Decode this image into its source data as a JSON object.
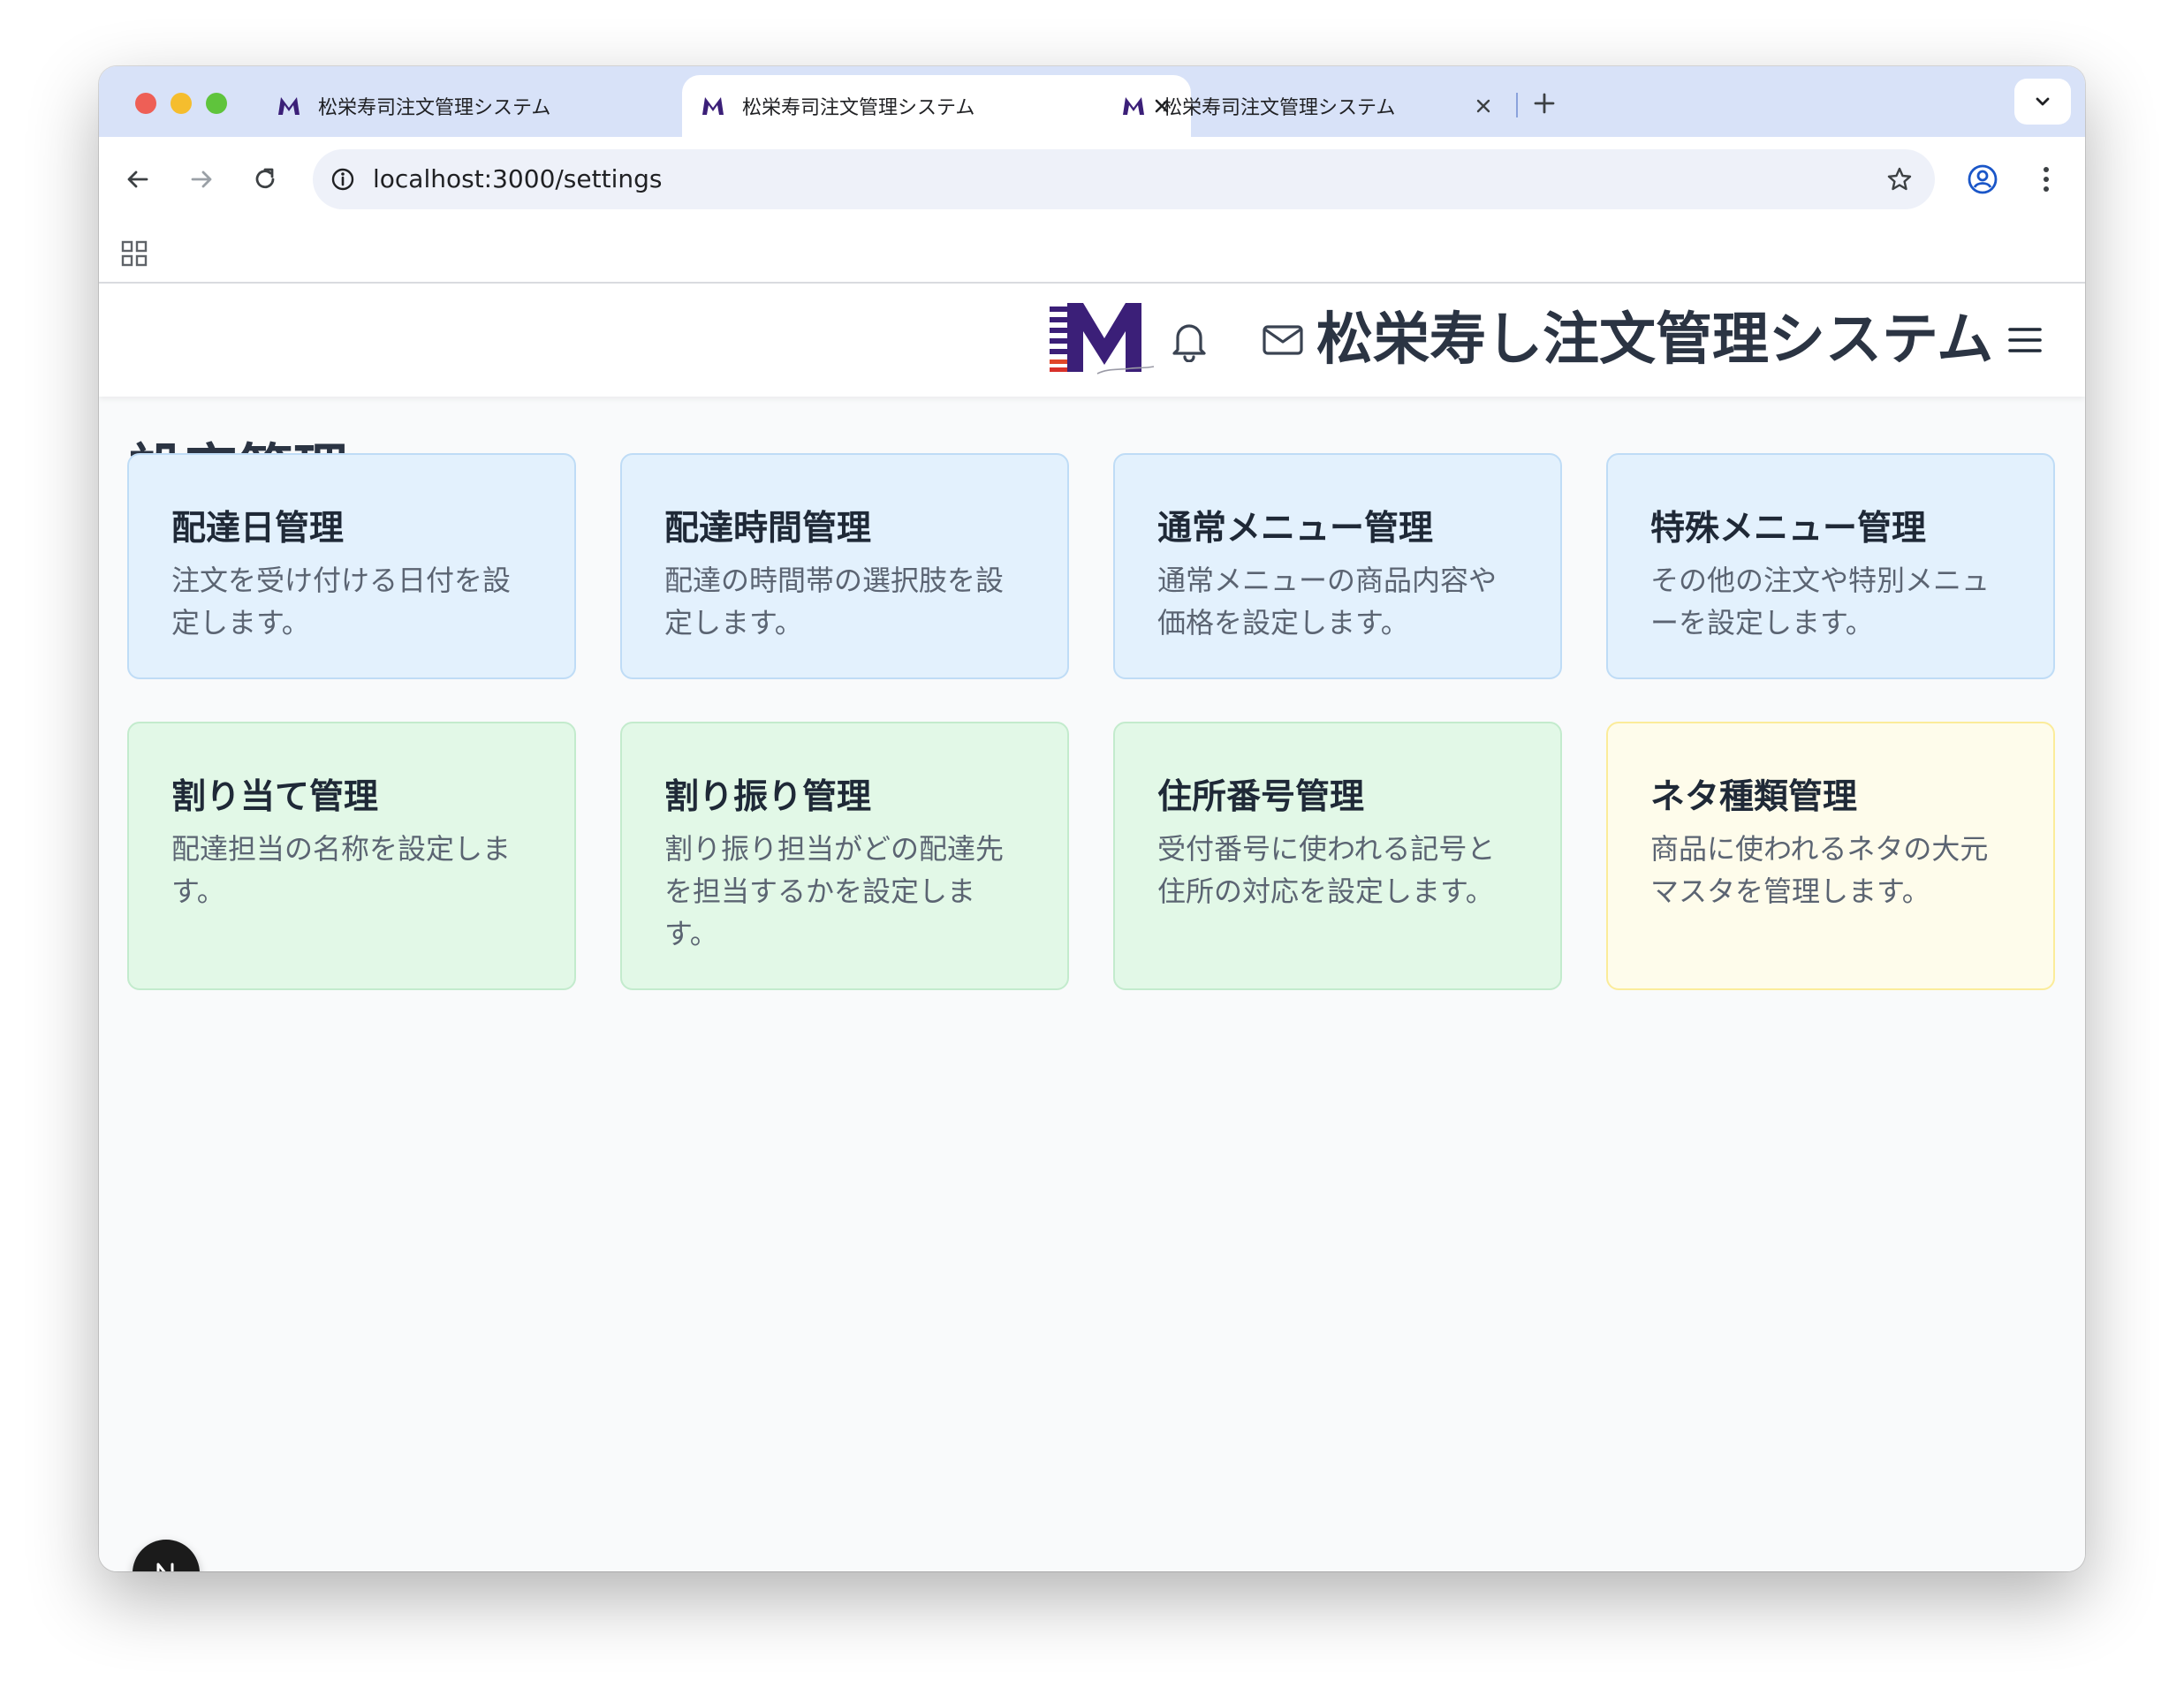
{
  "browser": {
    "tabs": [
      {
        "title": "松栄寿司注文管理システム",
        "active": false
      },
      {
        "title": "松栄寿司注文管理システム",
        "active": true
      },
      {
        "title": "松栄寿司注文管理システム",
        "active": false
      }
    ],
    "url": "localhost:3000/settings",
    "icons": {
      "favicon": "m-logo-icon",
      "tab_close": "close-icon",
      "new_tab": "plus-icon",
      "tab_menu": "chevron-down-icon",
      "back": "arrow-left-icon",
      "forward": "arrow-right-icon",
      "reload": "reload-icon",
      "site_info": "info-icon",
      "bookmark": "star-icon",
      "profile": "profile-icon",
      "menu": "kebab-icon",
      "apps": "apps-grid-icon"
    }
  },
  "header": {
    "app_title": "松栄寿し注文管理システム",
    "icons": {
      "logo": "brand-logo",
      "notifications": "bell-icon",
      "mail": "mail-icon",
      "menu": "hamburger-icon"
    }
  },
  "page": {
    "title": "設定管理"
  },
  "cards": [
    {
      "title": "配達日管理",
      "description": "注文を受け付ける日付を設定します。",
      "color": "#e3f1fd"
    },
    {
      "title": "配達時間管理",
      "description": "配達の時間帯の選択肢を設定します。",
      "color": "#e3f1fd"
    },
    {
      "title": "通常メニュー管理",
      "description": "通常メニューの商品内容や価格を設定します。",
      "color": "#e3f1fd"
    },
    {
      "title": "特殊メニュー管理",
      "description": "その他の注文や特別メニューを設定します。",
      "color": "#e3f1fd"
    },
    {
      "title": "割り当て管理",
      "description": "配達担当の名称を設定します。",
      "color": "#e2f8e7"
    },
    {
      "title": "割り振り管理",
      "description": "割り振り担当がどの配達先を担当するかを設定します。",
      "color": "#e2f8e7"
    },
    {
      "title": "住所番号管理",
      "description": "受付番号に使われる記号と住所の対応を設定します。",
      "color": "#e2f8e7"
    },
    {
      "title": "ネタ種類管理",
      "description": "商品に使われるネタの大元マスタを管理します。",
      "color": "#fefceb"
    }
  ],
  "dev_badge": {
    "label": "N",
    "icon": "nextjs-icon"
  }
}
